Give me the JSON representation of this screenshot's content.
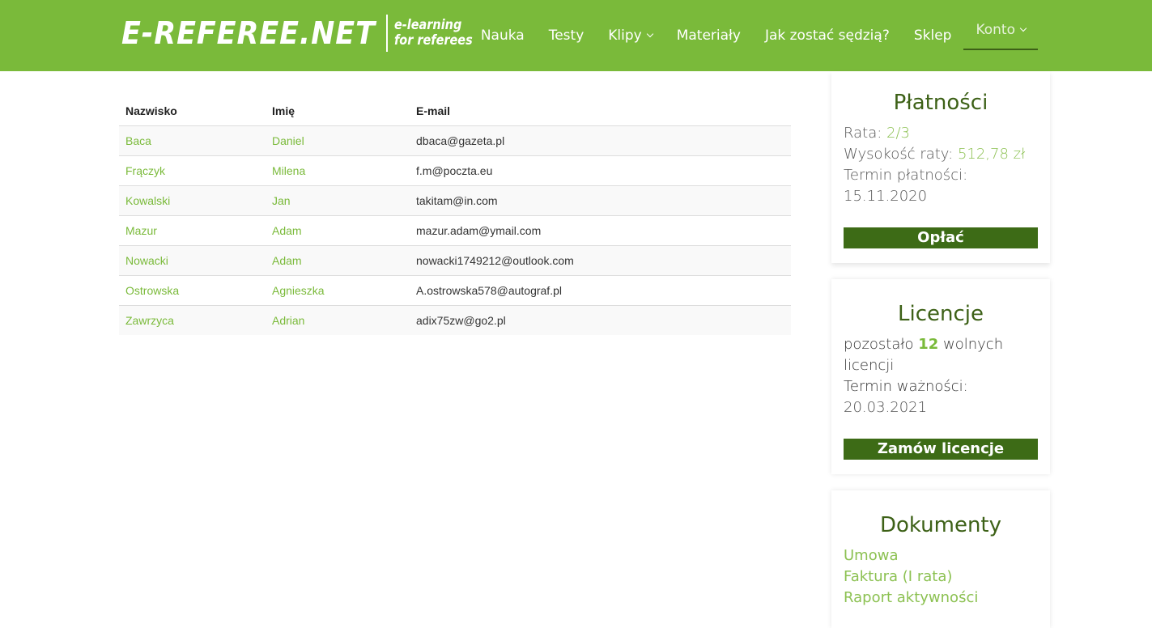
{
  "header": {
    "logo_main": "E-REFEREE.NET",
    "logo_sub_1": "e-learning",
    "logo_sub_2": "for referees",
    "nav": [
      {
        "label": "Nauka"
      },
      {
        "label": "Testy"
      },
      {
        "label": "Klipy"
      },
      {
        "label": "Materiały"
      },
      {
        "label": "Jak zostać sędzią?"
      },
      {
        "label": "Sklep"
      },
      {
        "label": "Konto"
      }
    ]
  },
  "table": {
    "columns": [
      "Nazwisko",
      "Imię",
      "E-mail"
    ],
    "rows": [
      {
        "surname": "Baca",
        "name": "Daniel",
        "email": "dbaca@gazeta.pl"
      },
      {
        "surname": "Frączyk",
        "name": "Milena",
        "email": "f.m@poczta.eu"
      },
      {
        "surname": "Kowalski",
        "name": "Jan",
        "email": "takitam@in.com"
      },
      {
        "surname": "Mazur",
        "name": "Adam",
        "email": "mazur.adam@ymail.com"
      },
      {
        "surname": "Nowacki",
        "name": "Adam",
        "email": "nowacki1749212@outlook.com"
      },
      {
        "surname": "Ostrowska",
        "name": "Agnieszka",
        "email": "A.ostrowska578@autograf.pl"
      },
      {
        "surname": "Zawrzyca",
        "name": "Adrian",
        "email": "adix75zw@go2.pl"
      }
    ]
  },
  "payments": {
    "title": "Płatności",
    "rate_label": "Rata: ",
    "rate_value": "2/3",
    "amount_label": "Wysokość raty: ",
    "amount_value": "512,78 zł",
    "due_label": "Termin płatności:",
    "due_value": "15.11.2020",
    "button": "Opłać"
  },
  "licenses": {
    "title": "Licencje",
    "remaining_prefix": "pozostało ",
    "remaining_count": "12",
    "remaining_suffix": " wolnych licencji",
    "validity_label": "Termin ważności:",
    "validity_value": "20.03.2021",
    "button": "Zamów licencje"
  },
  "documents": {
    "title": "Dokumenty",
    "links": [
      "Umowa",
      "Faktura (I rata)",
      "Raport aktywności"
    ]
  },
  "colors": {
    "header_bg": "#7aba3a",
    "accent_green": "#8cc152",
    "dark_green": "#3d6b16"
  }
}
